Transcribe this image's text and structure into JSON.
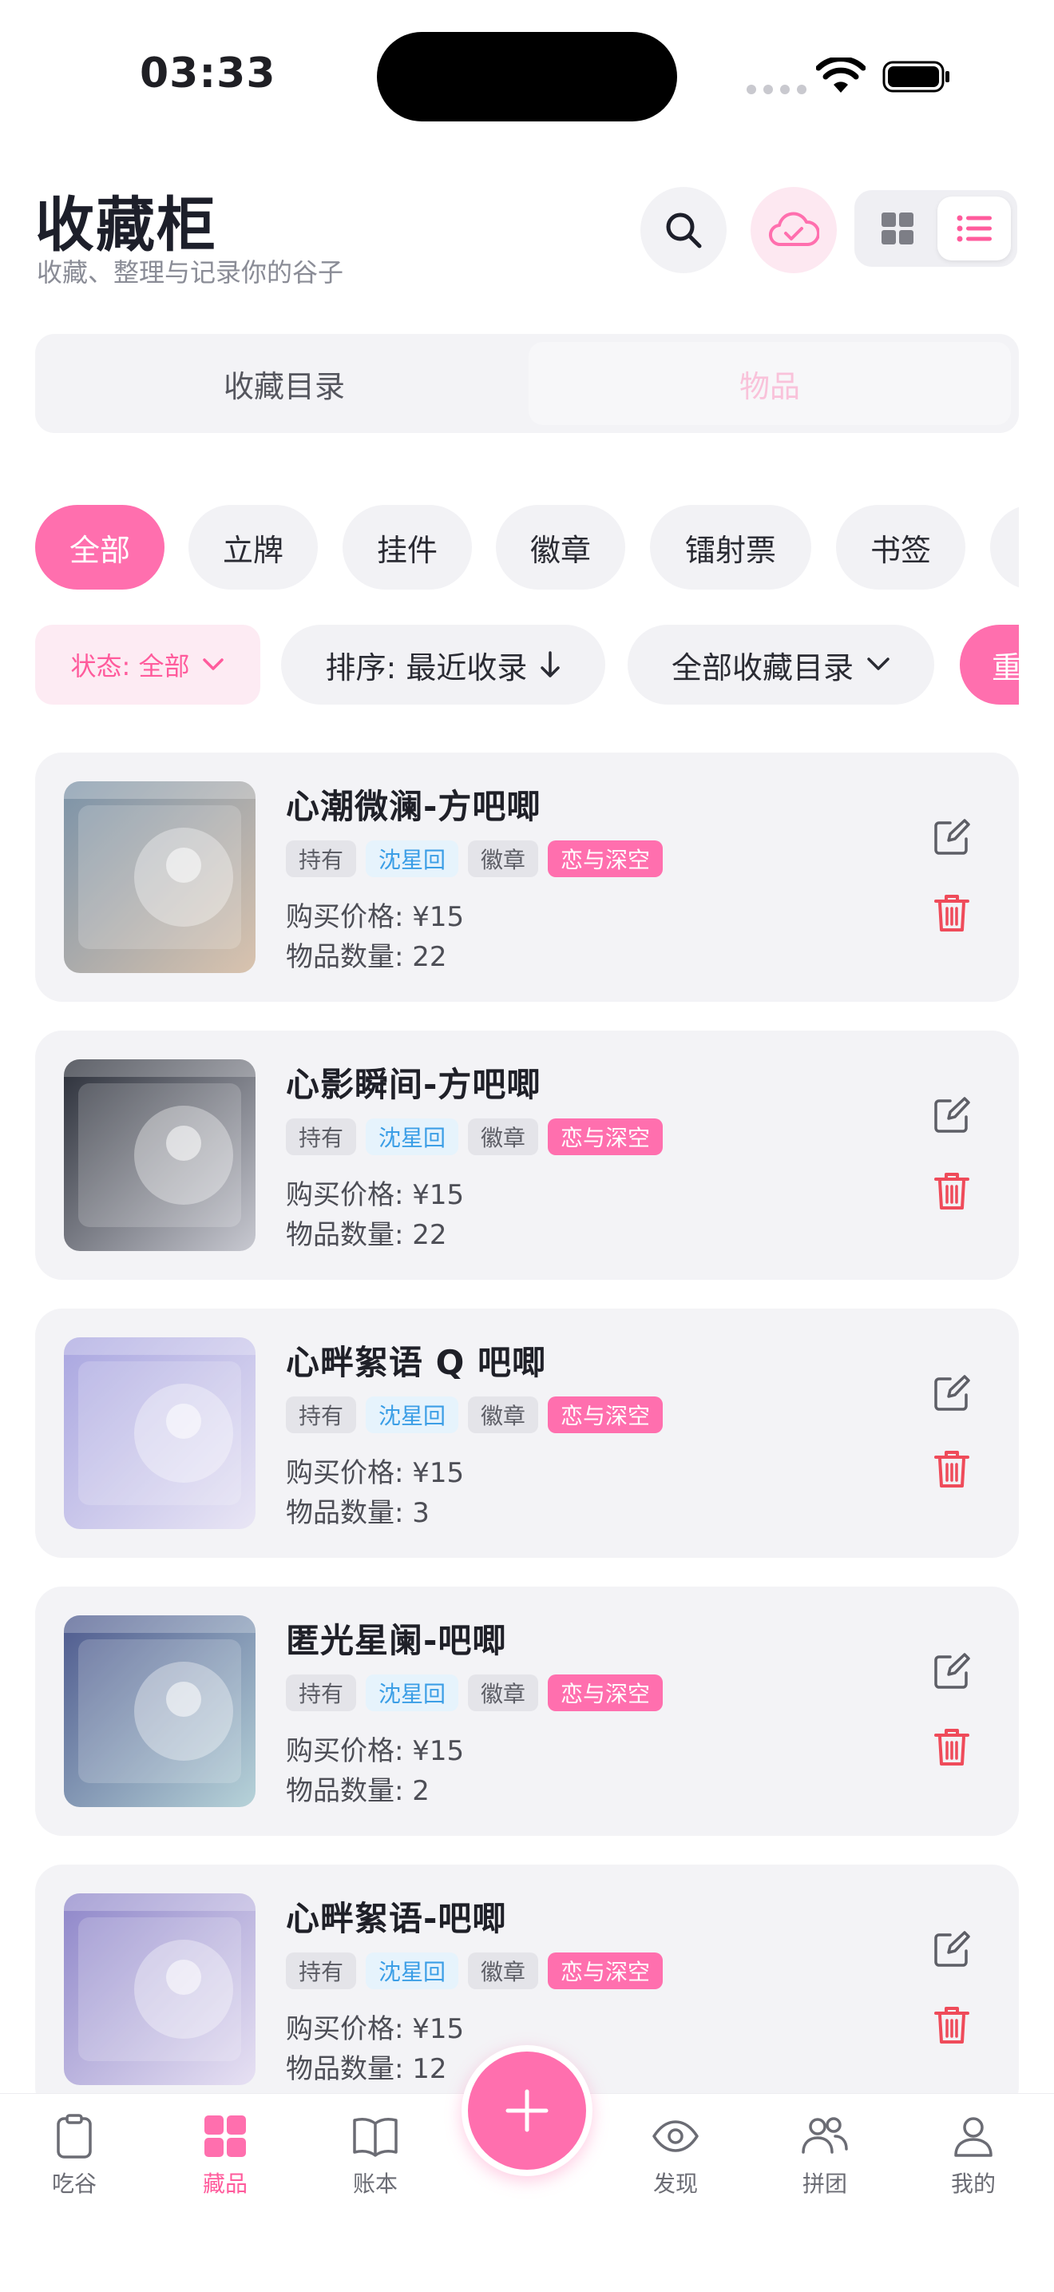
{
  "status_bar": {
    "time": "03:33"
  },
  "header": {
    "title": "收藏柜",
    "subtitle": "收藏、整理与记录你的谷子"
  },
  "segments": [
    "收藏目录",
    "物品"
  ],
  "categories": [
    "全部",
    "立牌",
    "挂件",
    "徽章",
    "镭射票",
    "书签"
  ],
  "filters": {
    "status": "状态: 全部",
    "sort": "排序: 最近收录",
    "catalog": "全部收藏目录",
    "reset": "重"
  },
  "items": [
    {
      "title": "心潮微澜-方吧唧",
      "tags": [
        "持有",
        "沈星回",
        "徽章",
        "恋与深空"
      ],
      "price": "购买价格: ¥15",
      "qty": "物品数量: 22",
      "thumb_colors": [
        "#7c93a8",
        "#d9c3ae"
      ]
    },
    {
      "title": "心影瞬间-方吧唧",
      "tags": [
        "持有",
        "沈星回",
        "徽章",
        "恋与深空"
      ],
      "price": "购买价格: ¥15",
      "qty": "物品数量: 22",
      "thumb_colors": [
        "#2a2e38",
        "#c8c9d1"
      ]
    },
    {
      "title": "心畔絮语 Q 吧唧",
      "tags": [
        "持有",
        "沈星回",
        "徽章",
        "恋与深空"
      ],
      "price": "购买价格: ¥15",
      "qty": "物品数量: 3",
      "thumb_colors": [
        "#a9a6e0",
        "#e9e6f5"
      ]
    },
    {
      "title": "匿光星阑-吧唧",
      "tags": [
        "持有",
        "沈星回",
        "徽章",
        "恋与深空"
      ],
      "price": "购买价格: ¥15",
      "qty": "物品数量: 2",
      "thumb_colors": [
        "#4e5a8e",
        "#b7d3d9"
      ]
    },
    {
      "title": "心畔絮语-吧唧",
      "tags": [
        "持有",
        "沈星回",
        "徽章",
        "恋与深空"
      ],
      "price": "购买价格: ¥15",
      "qty": "物品数量: 12",
      "thumb_colors": [
        "#8e86c9",
        "#e7e1f3"
      ]
    }
  ],
  "tabbar": [
    "吃谷",
    "藏品",
    "账本",
    "发现",
    "拼团",
    "我的"
  ],
  "colors": {
    "accent": "#ff6fae",
    "delete": "#ef4b5a",
    "character_tag": "#3b9ee6"
  }
}
